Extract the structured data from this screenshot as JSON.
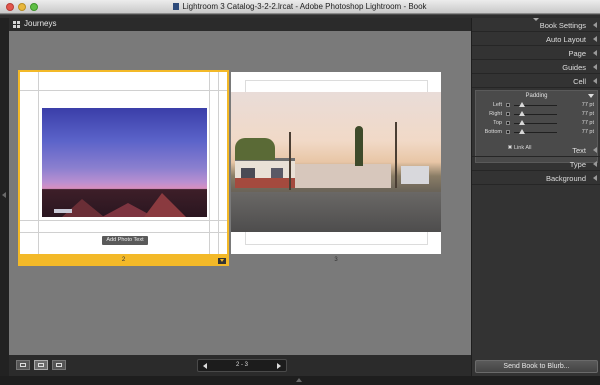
{
  "window": {
    "title": "Lightroom 3 Catalog-3-2-2.lrcat - Adobe Photoshop Lightroom - Book"
  },
  "header": {
    "book_title": "Journeys"
  },
  "pages": {
    "left": {
      "number": "2",
      "add_photo_text_label": "Add Photo Text",
      "selected": true
    },
    "right": {
      "number": "3"
    }
  },
  "toolbar": {
    "page_range": "2 - 3"
  },
  "right_panel": {
    "sections_top": [
      "Book Settings",
      "Auto Layout",
      "Page",
      "Guides",
      "Cell"
    ],
    "sections_bottom": [
      "Text",
      "Type",
      "Background"
    ],
    "padding": {
      "title": "Padding",
      "rows": [
        {
          "label": "Left",
          "value": "77 pt"
        },
        {
          "label": "Right",
          "value": "77 pt"
        },
        {
          "label": "Top",
          "value": "77 pt"
        },
        {
          "label": "Bottom",
          "value": "77 pt"
        }
      ],
      "link_all_label": "Link All"
    },
    "send_button_label": "Send Book to Blurb..."
  },
  "colors": {
    "selection_accent": "#f3b928",
    "panel_bg": "#333333",
    "canvas_bg": "#7a7a7a"
  }
}
